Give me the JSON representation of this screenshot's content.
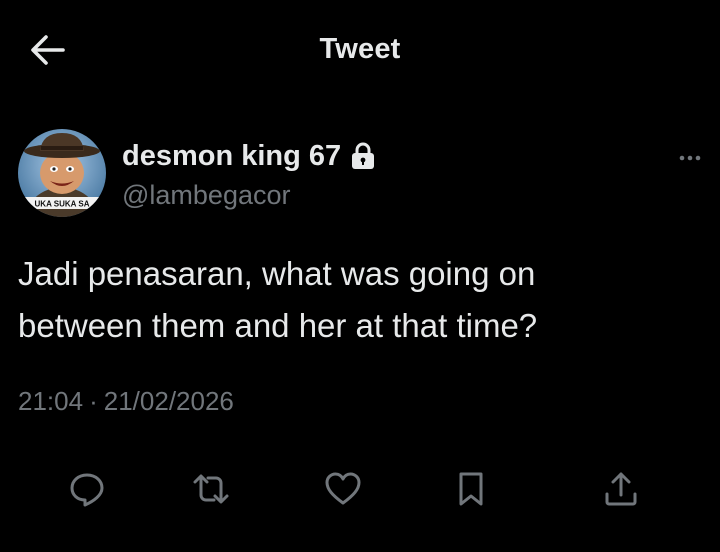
{
  "header": {
    "title": "Tweet",
    "back_icon": "arrow-left-icon"
  },
  "author": {
    "display_name": "desmon king 67",
    "handle": "@lambegacor",
    "protected": true,
    "lock_icon": "lock-icon",
    "avatar_caption": "UKA SUKA SA",
    "more_icon": "more-horizontal-icon"
  },
  "tweet": {
    "text": "Jadi penasaran, what was going on\nbetween them and her at that time?",
    "time": "21:04",
    "separator": "·",
    "date": "21/02/2026"
  },
  "actions": [
    {
      "name": "reply",
      "icon": "reply-icon"
    },
    {
      "name": "retweet",
      "icon": "retweet-icon"
    },
    {
      "name": "like",
      "icon": "heart-icon"
    },
    {
      "name": "bookmark",
      "icon": "bookmark-icon"
    },
    {
      "name": "share",
      "icon": "share-icon"
    }
  ],
  "colors": {
    "background": "#000000",
    "primary_text": "#e7e9ea",
    "secondary_text": "#71767b"
  }
}
